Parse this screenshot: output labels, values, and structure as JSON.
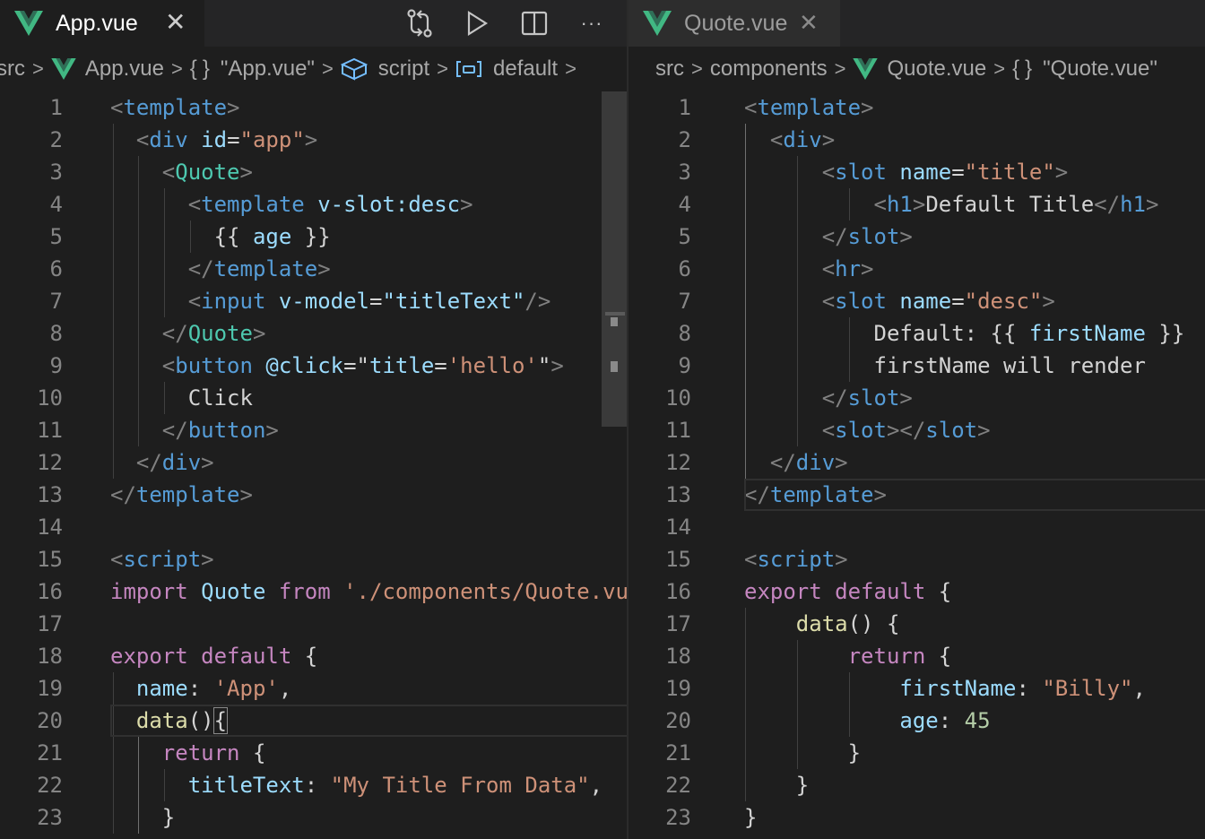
{
  "left": {
    "tab": {
      "title": "App.vue",
      "close": "✕"
    },
    "actions": [
      "compare-icon",
      "run-icon",
      "split-editor-icon",
      "more-icon"
    ],
    "more_label": "···",
    "breadcrumb": {
      "folder": "src",
      "sep": ">",
      "file": "App.vue",
      "braces": "{}",
      "object": "\"App.vue\"",
      "script": "script",
      "default": "default"
    },
    "lines": [
      [
        [
          "<",
          "p"
        ],
        [
          "template",
          "tag"
        ],
        [
          ">",
          "p"
        ]
      ],
      [
        [
          "<",
          "p"
        ],
        [
          "div",
          "tag"
        ],
        [
          " ",
          "t"
        ],
        [
          "id",
          "attr"
        ],
        [
          "=",
          "t"
        ],
        [
          "\"app\"",
          "str"
        ],
        [
          ">",
          "p"
        ]
      ],
      [
        [
          "<",
          "p"
        ],
        [
          "Quote",
          "comp"
        ],
        [
          ">",
          "p"
        ]
      ],
      [
        [
          "<",
          "p"
        ],
        [
          "template",
          "tag"
        ],
        [
          " ",
          "t"
        ],
        [
          "v-slot:desc",
          "attr"
        ],
        [
          ">",
          "p"
        ]
      ],
      [
        [
          "{{ ",
          "t"
        ],
        [
          "age",
          "attr"
        ],
        [
          " }}",
          "t"
        ]
      ],
      [
        [
          "</",
          "p"
        ],
        [
          "template",
          "tag"
        ],
        [
          ">",
          "p"
        ]
      ],
      [
        [
          "<",
          "p"
        ],
        [
          "input",
          "tag"
        ],
        [
          " ",
          "t"
        ],
        [
          "v-model",
          "attr"
        ],
        [
          "=",
          "t"
        ],
        [
          "\"titleText\"",
          "attr"
        ],
        [
          "/>",
          "p"
        ]
      ],
      [
        [
          "</",
          "p"
        ],
        [
          "Quote",
          "comp"
        ],
        [
          ">",
          "p"
        ]
      ],
      [
        [
          "<",
          "p"
        ],
        [
          "button",
          "tag"
        ],
        [
          " ",
          "t"
        ],
        [
          "@click",
          "attr"
        ],
        [
          "=\"",
          "t"
        ],
        [
          "title",
          "attr"
        ],
        [
          "=",
          "t"
        ],
        [
          "'hello'",
          "str"
        ],
        [
          "\"",
          "t"
        ],
        [
          ">",
          "p"
        ]
      ],
      [
        [
          "Click",
          "t"
        ]
      ],
      [
        [
          "</",
          "p"
        ],
        [
          "button",
          "tag"
        ],
        [
          ">",
          "p"
        ]
      ],
      [
        [
          "</",
          "p"
        ],
        [
          "div",
          "tag"
        ],
        [
          ">",
          "p"
        ]
      ],
      [
        [
          "</",
          "p"
        ],
        [
          "template",
          "tag"
        ],
        [
          ">",
          "p"
        ]
      ],
      [],
      [
        [
          "<",
          "p"
        ],
        [
          "script",
          "tag"
        ],
        [
          ">",
          "p"
        ]
      ],
      [
        [
          "import",
          "kw"
        ],
        [
          " ",
          "t"
        ],
        [
          "Quote",
          "attr"
        ],
        [
          " ",
          "t"
        ],
        [
          "from",
          "kw"
        ],
        [
          " ",
          "t"
        ],
        [
          "'./components/Quote.vu",
          "str"
        ]
      ],
      [],
      [
        [
          "export",
          "kw"
        ],
        [
          " ",
          "t"
        ],
        [
          "default",
          "kw"
        ],
        [
          " {",
          "t"
        ]
      ],
      [
        [
          "name",
          "attr"
        ],
        [
          ": ",
          "t"
        ],
        [
          "'App'",
          "str"
        ],
        [
          ",",
          "t"
        ]
      ],
      [
        [
          "data",
          "fn"
        ],
        [
          "()",
          "t"
        ],
        [
          "{",
          "brk"
        ]
      ],
      [
        [
          "return",
          "kw"
        ],
        [
          " {",
          "t"
        ]
      ],
      [
        [
          "titleText",
          "attr"
        ],
        [
          ": ",
          "t"
        ],
        [
          "\"My Title From Data\"",
          "str"
        ],
        [
          ",",
          "t"
        ]
      ],
      [
        [
          "}",
          "t"
        ]
      ]
    ]
  },
  "right": {
    "tab": {
      "title": "Quote.vue",
      "close": "✕"
    },
    "breadcrumb": {
      "folder": "src",
      "sep": ">",
      "components": "components",
      "file": "Quote.vue",
      "braces": "{}",
      "object": "\"Quote.vue\""
    },
    "lines": [
      [
        [
          "<",
          "p"
        ],
        [
          "template",
          "tag"
        ],
        [
          ">",
          "p"
        ]
      ],
      [
        [
          "<",
          "p"
        ],
        [
          "div",
          "tag"
        ],
        [
          ">",
          "p"
        ]
      ],
      [
        [
          "<",
          "p"
        ],
        [
          "slot",
          "tag"
        ],
        [
          " ",
          "t"
        ],
        [
          "name",
          "attr"
        ],
        [
          "=",
          "t"
        ],
        [
          "\"title\"",
          "str"
        ],
        [
          ">",
          "p"
        ]
      ],
      [
        [
          "<",
          "p"
        ],
        [
          "h1",
          "tag"
        ],
        [
          ">",
          "p"
        ],
        [
          "Default Title",
          "t"
        ],
        [
          "</",
          "p"
        ],
        [
          "h1",
          "tag"
        ],
        [
          ">",
          "p"
        ]
      ],
      [
        [
          "</",
          "p"
        ],
        [
          "slot",
          "tag"
        ],
        [
          ">",
          "p"
        ]
      ],
      [
        [
          "<",
          "p"
        ],
        [
          "hr",
          "tag"
        ],
        [
          ">",
          "p"
        ]
      ],
      [
        [
          "<",
          "p"
        ],
        [
          "slot",
          "tag"
        ],
        [
          " ",
          "t"
        ],
        [
          "name",
          "attr"
        ],
        [
          "=",
          "t"
        ],
        [
          "\"desc\"",
          "str"
        ],
        [
          ">",
          "p"
        ]
      ],
      [
        [
          "Default: {{ ",
          "t"
        ],
        [
          "firstName",
          "attr"
        ],
        [
          " }}",
          "t"
        ]
      ],
      [
        [
          "firstName will render",
          "t"
        ]
      ],
      [
        [
          "</",
          "p"
        ],
        [
          "slot",
          "tag"
        ],
        [
          ">",
          "p"
        ]
      ],
      [
        [
          "<",
          "p"
        ],
        [
          "slot",
          "tag"
        ],
        [
          "></",
          "p"
        ],
        [
          "slot",
          "tag"
        ],
        [
          ">",
          "p"
        ]
      ],
      [
        [
          "</",
          "p"
        ],
        [
          "div",
          "tag"
        ],
        [
          ">",
          "p"
        ]
      ],
      [
        [
          "</",
          "p"
        ],
        [
          "template",
          "tag"
        ],
        [
          ">",
          "p"
        ]
      ],
      [],
      [
        [
          "<",
          "p"
        ],
        [
          "script",
          "tag"
        ],
        [
          ">",
          "p"
        ]
      ],
      [
        [
          "export",
          "kw"
        ],
        [
          " ",
          "t"
        ],
        [
          "default",
          "kw"
        ],
        [
          " {",
          "t"
        ]
      ],
      [
        [
          "data",
          "fn"
        ],
        [
          "() {",
          "t"
        ]
      ],
      [
        [
          "return",
          "kw"
        ],
        [
          " {",
          "t"
        ]
      ],
      [
        [
          "firstName",
          "attr"
        ],
        [
          ": ",
          "t"
        ],
        [
          "\"Billy\"",
          "str"
        ],
        [
          ",",
          "t"
        ]
      ],
      [
        [
          "age",
          "attr"
        ],
        [
          ": ",
          "t"
        ],
        [
          "45",
          "num"
        ]
      ],
      [
        [
          "}",
          "t"
        ]
      ],
      [
        [
          "}",
          "t"
        ]
      ],
      [
        [
          "}",
          "t"
        ]
      ]
    ]
  }
}
